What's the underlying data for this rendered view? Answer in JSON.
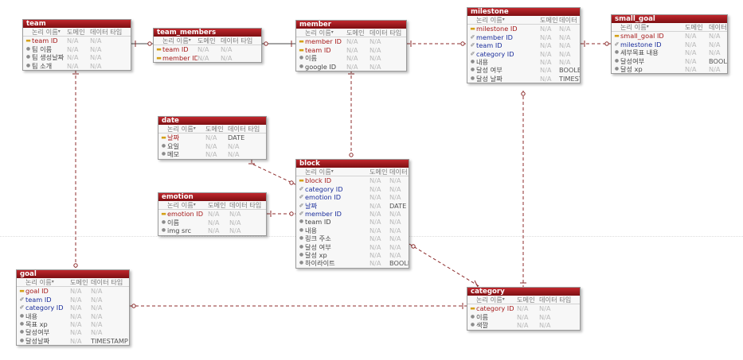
{
  "labels": {
    "logical_name": "논리 이름",
    "domain": "도메인",
    "data_type": "데이터 타입"
  },
  "colors": {
    "title_bar": "#9b171c",
    "relationship_line": "#8c2b2b",
    "primary_key": "#a61b1b",
    "foreign_key": "#1c2f9c"
  },
  "entities": {
    "team": {
      "title": "team",
      "rows": [
        {
          "name": "team ID",
          "kind": "pk",
          "icon": "key-icon",
          "domain": "N/A",
          "type": "N/A"
        },
        {
          "name": "팀 이름",
          "kind": "attr",
          "icon": "attribute-icon",
          "domain": "N/A",
          "type": "N/A"
        },
        {
          "name": "팀 생성날짜",
          "kind": "attr",
          "icon": "attribute-icon",
          "domain": "N/A",
          "type": "N/A"
        },
        {
          "name": "팀 소개",
          "kind": "attr",
          "icon": "attribute-icon",
          "domain": "N/A",
          "type": "N/A"
        }
      ]
    },
    "team_members": {
      "title": "team_members",
      "rows": [
        {
          "name": "team ID",
          "kind": "pkfk",
          "icon": "key-fk-icon",
          "domain": "N/A",
          "type": "N/A"
        },
        {
          "name": "member ID",
          "kind": "pkfk",
          "icon": "key-fk-icon",
          "domain": "N/A",
          "type": "N/A"
        }
      ]
    },
    "member": {
      "title": "member",
      "rows": [
        {
          "name": "member ID",
          "kind": "pk",
          "icon": "key-icon",
          "domain": "N/A",
          "type": "N/A"
        },
        {
          "name": "team ID",
          "kind": "pk",
          "icon": "key-icon",
          "domain": "N/A",
          "type": "N/A"
        },
        {
          "name": "이름",
          "kind": "attr",
          "icon": "attribute-icon",
          "domain": "N/A",
          "type": "N/A"
        },
        {
          "name": "google ID",
          "kind": "attr",
          "icon": "attribute-icon",
          "domain": "N/A",
          "type": "N/A"
        }
      ]
    },
    "milestone": {
      "title": "milestone",
      "rows": [
        {
          "name": "milestone ID",
          "kind": "pk",
          "icon": "key-icon",
          "domain": "N/A",
          "type": "N/A"
        },
        {
          "name": "member ID",
          "kind": "fk",
          "icon": "foreign-key-icon",
          "domain": "N/A",
          "type": "N/A"
        },
        {
          "name": "team ID",
          "kind": "fk",
          "icon": "foreign-key-icon",
          "domain": "N/A",
          "type": "N/A"
        },
        {
          "name": "category ID",
          "kind": "fk",
          "icon": "foreign-key-icon",
          "domain": "N/A",
          "type": "N/A"
        },
        {
          "name": "내용",
          "kind": "attr",
          "icon": "attribute-icon",
          "domain": "N/A",
          "type": "N/A"
        },
        {
          "name": "달성 여부",
          "kind": "attr",
          "icon": "attribute-icon",
          "domain": "N/A",
          "type": "BOOLEAN"
        },
        {
          "name": "달성 날짜",
          "kind": "attr",
          "icon": "attribute-icon",
          "domain": "N/A",
          "type": "TIMESTAMP"
        }
      ]
    },
    "small_goal": {
      "title": "small_goal",
      "rows": [
        {
          "name": "small_goal ID",
          "kind": "pk",
          "icon": "key-icon",
          "domain": "N/A",
          "type": "N/A"
        },
        {
          "name": "milestone ID",
          "kind": "fk",
          "icon": "foreign-key-icon",
          "domain": "N/A",
          "type": "N/A"
        },
        {
          "name": "세부목표 내용",
          "kind": "attr",
          "icon": "attribute-icon",
          "domain": "N/A",
          "type": "N/A"
        },
        {
          "name": "달성여부",
          "kind": "attr",
          "icon": "attribute-icon",
          "domain": "N/A",
          "type": "BOOLEAN"
        },
        {
          "name": "달성 xp",
          "kind": "attr",
          "icon": "attribute-icon",
          "domain": "N/A",
          "type": "N/A"
        }
      ]
    },
    "date": {
      "title": "date",
      "rows": [
        {
          "name": "날짜",
          "kind": "pk",
          "icon": "key-icon",
          "domain": "N/A",
          "type": "DATE"
        },
        {
          "name": "요일",
          "kind": "attr",
          "icon": "attribute-icon",
          "domain": "N/A",
          "type": "N/A"
        },
        {
          "name": "메모",
          "kind": "attr",
          "icon": "attribute-icon",
          "domain": "N/A",
          "type": "N/A"
        }
      ]
    },
    "emotion": {
      "title": "emotion",
      "rows": [
        {
          "name": "emotion ID",
          "kind": "pk",
          "icon": "key-icon",
          "domain": "N/A",
          "type": "N/A"
        },
        {
          "name": "이름",
          "kind": "attr",
          "icon": "attribute-icon",
          "domain": "N/A",
          "type": "N/A"
        },
        {
          "name": "img src",
          "kind": "attr",
          "icon": "attribute-icon",
          "domain": "N/A",
          "type": "N/A"
        }
      ]
    },
    "block": {
      "title": "block",
      "rows": [
        {
          "name": "block ID",
          "kind": "pk",
          "icon": "key-icon",
          "domain": "N/A",
          "type": "N/A"
        },
        {
          "name": "category ID",
          "kind": "fk",
          "icon": "foreign-key-icon",
          "domain": "N/A",
          "type": "N/A"
        },
        {
          "name": "emotion ID",
          "kind": "fk",
          "icon": "foreign-key-icon",
          "domain": "N/A",
          "type": "N/A"
        },
        {
          "name": "날짜",
          "kind": "fk",
          "icon": "foreign-key-icon",
          "domain": "N/A",
          "type": "DATE"
        },
        {
          "name": "member ID",
          "kind": "fk",
          "icon": "foreign-key-icon",
          "domain": "N/A",
          "type": "N/A"
        },
        {
          "name": "team ID",
          "kind": "attr",
          "icon": "attribute-icon",
          "domain": "N/A",
          "type": "N/A"
        },
        {
          "name": "내용",
          "kind": "attr",
          "icon": "attribute-icon",
          "domain": "N/A",
          "type": "N/A"
        },
        {
          "name": "링크 주소",
          "kind": "attr",
          "icon": "attribute-icon",
          "domain": "N/A",
          "type": "N/A"
        },
        {
          "name": "달성 여부",
          "kind": "attr",
          "icon": "attribute-icon",
          "domain": "N/A",
          "type": "N/A"
        },
        {
          "name": "달성 xp",
          "kind": "attr",
          "icon": "attribute-icon",
          "domain": "N/A",
          "type": "N/A"
        },
        {
          "name": "하이라이트",
          "kind": "attr",
          "icon": "attribute-icon",
          "domain": "N/A",
          "type": "BOOLEAN"
        }
      ]
    },
    "goal": {
      "title": "goal",
      "rows": [
        {
          "name": "goal ID",
          "kind": "pk",
          "icon": "key-icon",
          "domain": "N/A",
          "type": "N/A"
        },
        {
          "name": "team ID",
          "kind": "fk",
          "icon": "foreign-key-icon",
          "domain": "N/A",
          "type": "N/A"
        },
        {
          "name": "category ID",
          "kind": "fk",
          "icon": "foreign-key-icon",
          "domain": "N/A",
          "type": "N/A"
        },
        {
          "name": "내용",
          "kind": "attr",
          "icon": "attribute-icon",
          "domain": "N/A",
          "type": "N/A"
        },
        {
          "name": "목표 xp",
          "kind": "attr",
          "icon": "attribute-icon",
          "domain": "N/A",
          "type": "N/A"
        },
        {
          "name": "달성여부",
          "kind": "attr",
          "icon": "attribute-icon",
          "domain": "N/A",
          "type": "N/A"
        },
        {
          "name": "달성날짜",
          "kind": "attr",
          "icon": "attribute-icon",
          "domain": "N/A",
          "type": "TIMESTAMP"
        }
      ]
    },
    "category": {
      "title": "category",
      "rows": [
        {
          "name": "category ID",
          "kind": "pk",
          "icon": "key-icon",
          "domain": "N/A",
          "type": "N/A"
        },
        {
          "name": "이름",
          "kind": "attr",
          "icon": "attribute-icon",
          "domain": "N/A",
          "type": "N/A"
        },
        {
          "name": "색깔",
          "kind": "attr",
          "icon": "attribute-icon",
          "domain": "N/A",
          "type": "N/A"
        }
      ]
    }
  }
}
